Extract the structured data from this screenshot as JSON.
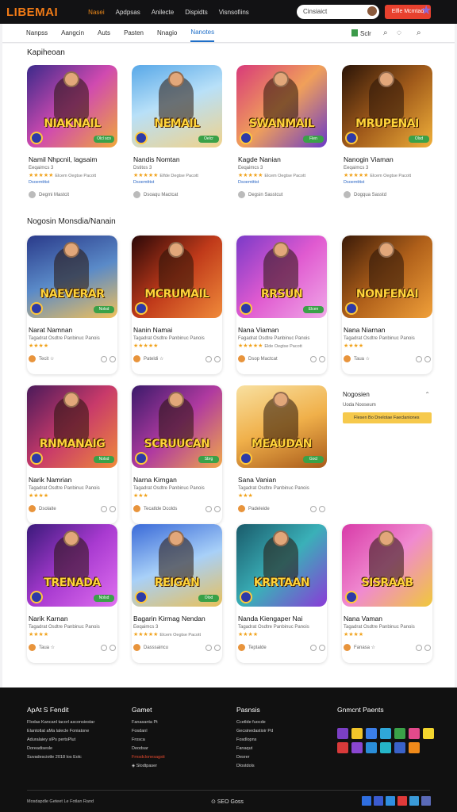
{
  "header": {
    "logo": "LIBEMAI",
    "nav": [
      "Nasei",
      "Apdpsas",
      "Anilecte",
      "Dispidts",
      "Visnsofiins"
    ],
    "active_index": 0,
    "search_placeholder": "Cinsiaict",
    "cta_label": "Elfle Mcmtad"
  },
  "filters": {
    "tabs": [
      "Nanpss",
      "Aangcin",
      "Auts",
      "Pasten",
      "Nnagio",
      "Nanotes"
    ],
    "active_index": 5,
    "sort_label": "Sclr"
  },
  "sections": [
    {
      "title": "Kapiheoan"
    },
    {
      "title": "Nogosin Monsdia/Nanain"
    }
  ],
  "cards": [
    {
      "name": "Namil Nhpcnil, lagsaim",
      "sub": "Eeqaimcs 3",
      "rating": "★★★★★",
      "meta": "Elcem Oegtse Pacott",
      "link": "Dsoemtttst",
      "foot": "Degmi Mastcit",
      "thumb_title": "NIAKNAIL",
      "badge": "Olcl sco"
    },
    {
      "name": "Nandis Nomtan",
      "sub": "Dstitos 3",
      "rating": "★★★★★",
      "meta": "Elfde Degtse Pacott",
      "link": "Dsoemtttst",
      "foot": "Dsoaqu Mactcat",
      "thumb_title": "NEMAIL",
      "badge": "Oelcr"
    },
    {
      "name": "Kagde Nanian",
      "sub": "Eeqaimcs 3",
      "rating": "★★★★★",
      "meta": "Elcem Oegtse Pacott",
      "link": "Dsoemtttst",
      "foot": "Degsin Sasstcut",
      "thumb_title": "SWANMAIL",
      "badge": "Flen"
    },
    {
      "name": "Nanogin Viaman",
      "sub": "Eeqaimcs 3",
      "rating": "★★★★★",
      "meta": "Elcem Oegtse Pacott",
      "link": "Dsoemtttst",
      "foot": "Dogqua Sasstd",
      "thumb_title": "MRUPENAI",
      "badge": "Olsd"
    },
    {
      "name": "Narat Namnan",
      "sub": "Tagadrat Osdtre Panbinuc Panois",
      "rating": "★★★★",
      "meta": "",
      "link": "",
      "foot": "Tecit ☆",
      "thumb_title": "NAEVERAR",
      "badge": "Nolsd"
    },
    {
      "name": "Nanin Namai",
      "sub": "Tagadrat Osdtre Panbinuc Panois",
      "rating": "★★★★★",
      "meta": "",
      "link": "",
      "foot": "Pateldi ☆",
      "thumb_title": "MCRUMAIL",
      "badge": ""
    },
    {
      "name": "Nana Viaman",
      "sub": "Fagadrat Osdtre Panbinuc Panois",
      "rating": "★★★★★",
      "meta": "Elde Oegtse Pacott",
      "link": "",
      "foot": "Dsop Mactcat",
      "thumb_title": "RRSUN",
      "badge": "Elcen"
    },
    {
      "name": "Nana Niarnan",
      "sub": "Tagadrat Osdtre Panbinuc Panois",
      "rating": "★★★★",
      "meta": "",
      "link": "",
      "foot": "Taua ☆",
      "thumb_title": "NONFENAI",
      "badge": ""
    },
    {
      "name": "Narik Namrian",
      "sub": "Tagadrat Osdtre Panbinuc Panois",
      "rating": "★★★★",
      "meta": "",
      "link": "",
      "foot": "Dsolaite",
      "thumb_title": "RNMANAIG",
      "badge": "Nolsd"
    },
    {
      "name": "Narna Kirngan",
      "sub": "Tagadrat Osdtre Panbinuc Panois",
      "rating": "★★★",
      "meta": "",
      "link": "",
      "foot": "Tecatlde Dcolds",
      "thumb_title": "SCRUUCAN",
      "badge": "Sbrg"
    },
    {
      "name": "Sana Vanian",
      "sub": "Tagadrat Osdtre Panbinuc Panois",
      "rating": "★★★",
      "meta": "",
      "link": "",
      "foot": "Padeleide",
      "thumb_title": "MEAUDAN",
      "badge": "Gocl"
    },
    {
      "name": "Narik Karnan",
      "sub": "Tagadrat Osdtre Panbinuc Panois",
      "rating": "★★★★",
      "meta": "",
      "link": "",
      "foot": "Taua ☆",
      "thumb_title": "TRENADA",
      "badge": "Nolsd"
    },
    {
      "name": "Bagarin Kirmag Nendan",
      "sub": "Eeqaimcs 3",
      "rating": "★★★★★",
      "meta": "Elcem Oegtse Pacott",
      "link": "",
      "foot": "Dasssaincu",
      "thumb_title": "REIGAN",
      "badge": "Olod"
    },
    {
      "name": "Nanda Kiengaper Nai",
      "sub": "Tagadrat Osdtre Panbinuc Panois",
      "rating": "★★★★",
      "meta": "",
      "link": "",
      "foot": "Teptalde",
      "thumb_title": "KRRTAAN",
      "badge": ""
    },
    {
      "name": "Nana Vaman",
      "sub": "Tagadrat Osdtre Panbinuc Panois",
      "rating": "★★★★",
      "meta": "",
      "link": "",
      "foot": "Fanasa ☆",
      "thumb_title": "SISRAAB",
      "badge": ""
    }
  ],
  "widget": {
    "title": "Nogosien",
    "row": "Uoda Nooseum",
    "bar_label": "Flesen Bo Dnelotae Faeclaniones"
  },
  "footer": {
    "col1_title": "ApAt S Fendit",
    "col1_lines": [
      "Flodas Kancanl tacorl asconsiestar",
      "Elantotlat aMa lalecle Foniatone",
      "Aduralaiey slPs pertsPlut",
      "Doreadisesle",
      "Suvadesciotle 2018 los Eolc"
    ],
    "col2_title": "Gamet",
    "col2_lines": [
      "Fanasanta Pt",
      "Fosdanl",
      "Frosca",
      "Deodsar",
      "Frnsdclonesagsti"
    ],
    "col2_hl": 4,
    "col2_extra": "Slodtpaser",
    "col3_title": "Pasnsis",
    "col3_lines": [
      "Ccetlde fuocde",
      "Gecsinedastioir Pd",
      "Fosdlopns",
      "Fanaqut",
      "Desrer",
      "Dlostdols"
    ],
    "col4_title": "Gnmcnt Paents",
    "copyright": "Mosdapdle Geteet Le Fotlan Rand",
    "center": "SEO Goss"
  },
  "colors": {
    "accent": "#f08a1a",
    "link": "#1f6fc8",
    "cta": "#e8412e",
    "star": "#f1a21a"
  }
}
